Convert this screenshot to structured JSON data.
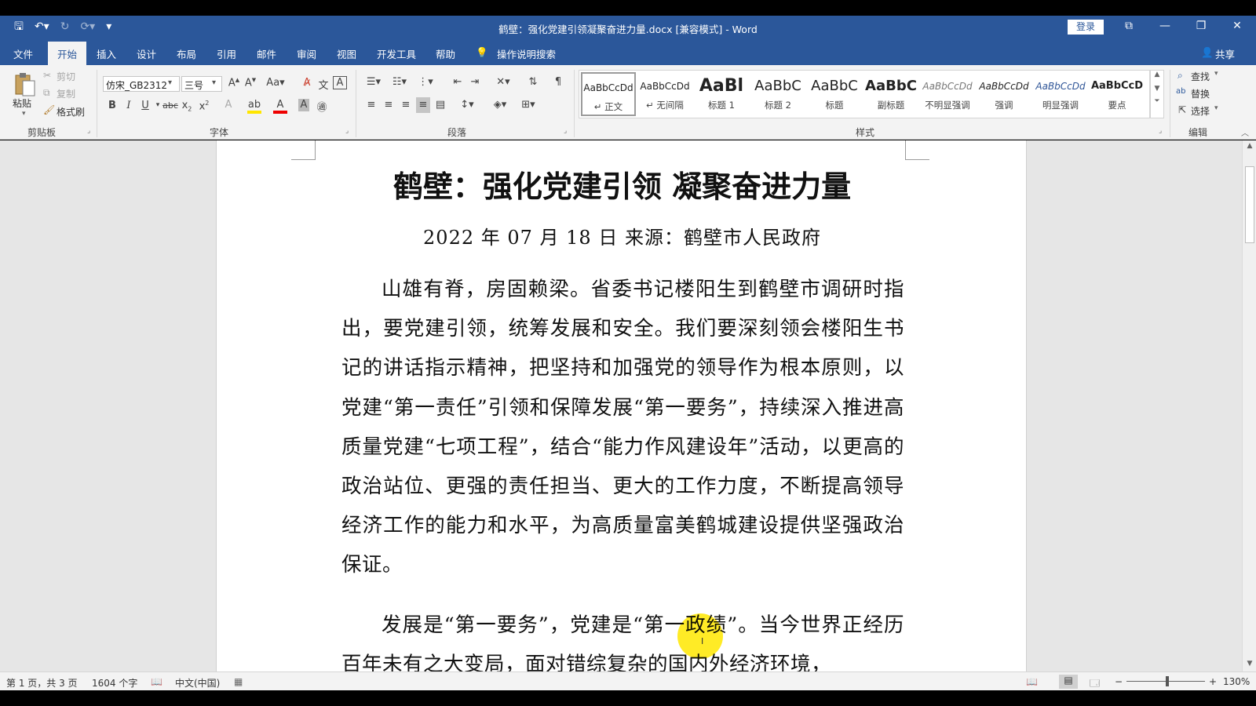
{
  "app": {
    "window_title": "鹤壁：强化党建引领凝聚奋进力量.docx [兼容模式]  -  Word",
    "login_label": "登录",
    "window_controls": {
      "ribbon_display": "⧉",
      "minimize": "—",
      "restore": "❐",
      "close": "✕"
    }
  },
  "qat": {
    "save": "🖫",
    "undo": "↶▾",
    "redo": "↻",
    "repeat": "⟳▾",
    "customize": "▾"
  },
  "tabs": [
    {
      "label": "文件"
    },
    {
      "label": "开始"
    },
    {
      "label": "插入"
    },
    {
      "label": "设计"
    },
    {
      "label": "布局"
    },
    {
      "label": "引用"
    },
    {
      "label": "邮件"
    },
    {
      "label": "审阅"
    },
    {
      "label": "视图"
    },
    {
      "label": "开发工具"
    },
    {
      "label": "帮助"
    }
  ],
  "active_tab": "开始",
  "tell_me": "操作说明搜索",
  "share": "共享",
  "ribbon": {
    "clipboard": {
      "group": "剪贴板",
      "paste": "粘贴",
      "cut": "剪切",
      "copy": "复制",
      "format_painter": "格式刷"
    },
    "font": {
      "group": "字体",
      "font_name": "仿宋_GB2312",
      "font_size": "三号"
    },
    "paragraph": {
      "group": "段落"
    },
    "styles": {
      "group": "样式",
      "items": [
        {
          "sample": "AaBbCcDd",
          "name": "↵ 正文"
        },
        {
          "sample": "AaBbCcDd",
          "name": "↵ 无间隔"
        },
        {
          "sample": "AaBl",
          "name": "标题 1"
        },
        {
          "sample": "AaBbC",
          "name": "标题 2"
        },
        {
          "sample": "AaBbC",
          "name": "标题"
        },
        {
          "sample": "AaBbC",
          "name": "副标题"
        },
        {
          "sample": "AaBbCcDd",
          "name": "不明显强调"
        },
        {
          "sample": "AaBbCcDd",
          "name": "强调"
        },
        {
          "sample": "AaBbCcDd",
          "name": "明显强调"
        },
        {
          "sample": "AaBbCcD",
          "name": "要点"
        }
      ]
    },
    "editing": {
      "group": "编辑",
      "find": "查找",
      "replace": "替换",
      "select": "选择"
    }
  },
  "document": {
    "title": "鹤壁：强化党建引领  凝聚奋进力量",
    "subtitle": "2022 年 07 月 18 日  来源：鹤壁市人民政府",
    "paragraphs": [
      "山雄有脊，房固赖梁。省委书记楼阳生到鹤壁市调研时指出，要党建引领，统筹发展和安全。我们要深刻领会楼阳生书记的讲话指示精神，把坚持和加强党的领导作为根本原则，以党建“第一责任”引领和保障发展“第一要务”，持续深入推进高质量党建“七项工程”，结合“能力作风建设年”活动，以更高的政治站位、更强的责任担当、更大的工作力度，不断提高领导经济工作的能力和水平，为高质量富美鹤城建设提供坚强政治保证。",
      "发展是“第一要务”，党建是“第一政绩”。当今世界正经历百年未有之大变局，面对错综复杂的国内外经济环境，"
    ]
  },
  "statusbar": {
    "page": "第 1 页，共 3 页",
    "words": "1604 个字",
    "language": "中文(中国)",
    "zoom": "130%",
    "zoom_minus": "−",
    "zoom_plus": "+"
  },
  "colors": {
    "accent": "#2b579a",
    "ribbon_bg": "#f3f3f3",
    "cursor_highlight": "#ffe800"
  }
}
